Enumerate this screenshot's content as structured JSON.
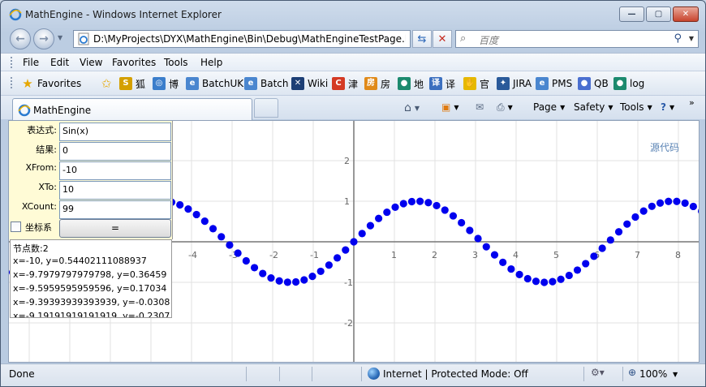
{
  "window": {
    "title": "MathEngine - Windows Internet Explorer"
  },
  "address": {
    "url": "D:\\MyProjects\\DYX\\MathEngine\\Bin\\Debug\\MathEngineTestPage.htm"
  },
  "search": {
    "placeholder": "百度"
  },
  "menu": [
    "File",
    "Edit",
    "View",
    "Favorites",
    "Tools",
    "Help"
  ],
  "favorites_bar": {
    "favorites_label": "Favorites",
    "items": [
      {
        "label": "狐",
        "icon": "sohu-icon",
        "color": "#d4a000"
      },
      {
        "label": "博",
        "icon": "blog-icon",
        "color": "#3b7ecb"
      },
      {
        "label": "BatchUK",
        "icon": "ie-page-icon",
        "color": "#4a86cf"
      },
      {
        "label": "Batch",
        "icon": "ie-page-icon",
        "color": "#4a86cf"
      },
      {
        "label": "Wiki",
        "icon": "wiki-icon",
        "color": "#1d3f75"
      },
      {
        "label": "津",
        "icon": "c-icon",
        "color": "#d43a24"
      },
      {
        "label": "房",
        "icon": "house-icon",
        "color": "#e08a1a"
      },
      {
        "label": "地",
        "icon": "globe-icon",
        "color": "#1c8a6e"
      },
      {
        "label": "译",
        "icon": "translate-icon",
        "color": "#3b6fbf"
      },
      {
        "label": "官",
        "icon": "hand-icon",
        "color": "#e6b800"
      },
      {
        "label": "JIRA",
        "icon": "jira-icon",
        "color": "#2a5a9a"
      },
      {
        "label": "PMS",
        "icon": "ie-page-icon",
        "color": "#4a86cf"
      },
      {
        "label": "QB",
        "icon": "circle-icon",
        "color": "#4a6fd0"
      },
      {
        "label": "log",
        "icon": "globe-icon",
        "color": "#1c8a6e"
      }
    ]
  },
  "tabs": [
    {
      "label": "MathEngine"
    }
  ],
  "command_bar": {
    "page": "Page",
    "safety": "Safety",
    "tools": "Tools"
  },
  "panel": {
    "labels": {
      "expression": "表达式:",
      "result": "结果:",
      "xfrom": "XFrom:",
      "xto": "XTo:",
      "xcount": "XCount:"
    },
    "values": {
      "expression": "Sin(x)",
      "result": "0",
      "xfrom": "-10",
      "xto": "10",
      "xcount": "99"
    },
    "axes_checkbox_label": "坐标系",
    "calculate_button": "="
  },
  "output": {
    "lines": [
      "节点数:2",
      "x=-10, y=0.54402111088937",
      "x=-9.7979797979798, y=0.36459",
      "x=-9.5959595959596, y=0.17034",
      "x=-9.39393939393939, y=-0.0308",
      "x=-9.19191919191919, y=-0.2307"
    ]
  },
  "source_link": "源代码",
  "status": {
    "text": "Done",
    "zone": "Internet | Protected Mode: Off",
    "zoom": "100%"
  },
  "chart_data": {
    "type": "scatter",
    "function": "Sin(x)",
    "x_range": [
      -10,
      10
    ],
    "point_count": 99,
    "visible_x_ticks": [
      -4,
      -3,
      -2,
      -1,
      1,
      2,
      3,
      4,
      5,
      6,
      7,
      8
    ],
    "visible_y_ticks": [
      2,
      1,
      -1,
      -2
    ],
    "x_tick_labels": [
      "-4",
      "-3",
      "-2",
      "-1",
      "1",
      "2",
      "3",
      "4",
      "5",
      "6",
      "7",
      "8"
    ],
    "y_tick_labels": [
      "2",
      "1",
      "-1",
      "-2"
    ],
    "point_color": "#0000ee",
    "grid": true
  }
}
